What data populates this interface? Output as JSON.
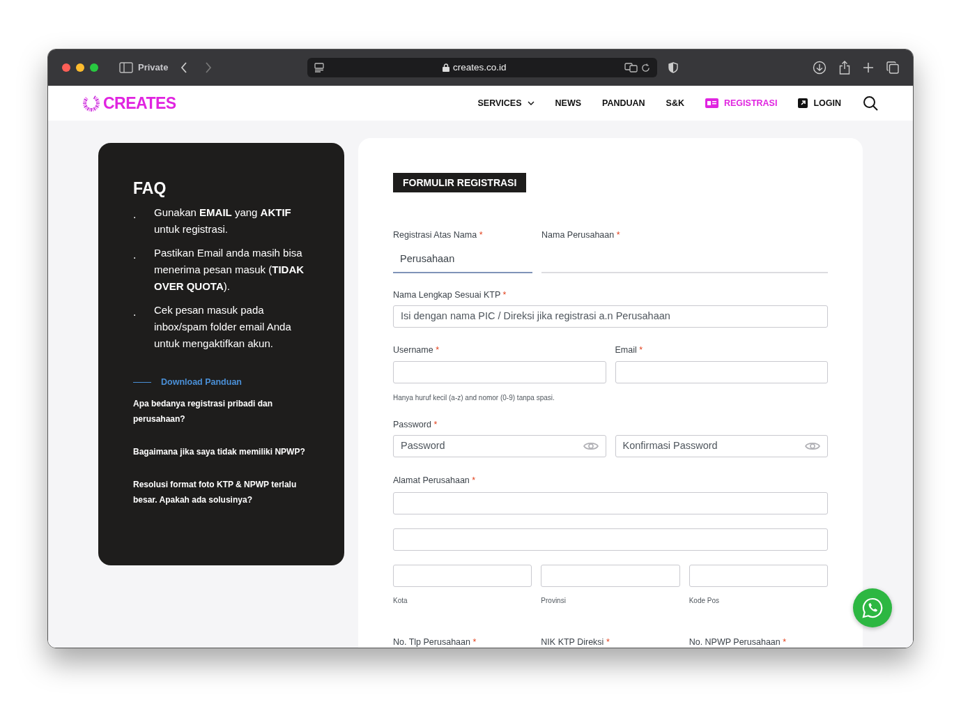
{
  "browser": {
    "mode": "Private",
    "url": "creates.co.id"
  },
  "site": {
    "logo": "CREATES",
    "nav": [
      {
        "label": "SERVICES",
        "kind": "dropdown",
        "selected": false
      },
      {
        "label": "NEWS",
        "kind": "link",
        "selected": false
      },
      {
        "label": "PANDUAN",
        "kind": "link",
        "selected": false
      },
      {
        "label": "S&K",
        "kind": "link",
        "selected": false
      },
      {
        "label": "REGISTRASI",
        "kind": "card",
        "selected": true
      },
      {
        "label": "LOGIN",
        "kind": "login",
        "selected": false
      }
    ]
  },
  "faq": {
    "title": "FAQ",
    "bullet": ".",
    "tips": [
      "Gunakan **EMAIL** yang **AKTIF** untuk registrasi.",
      "Pastikan Email anda masih bisa menerima pesan masuk (**TIDAK OVER QUOTA**).",
      "Cek pesan masuk pada inbox/spam folder email Anda untuk mengaktifkan akun."
    ],
    "download_link": "Download Panduan",
    "questions": [
      "Apa bedanya registrasi pribadi dan perusahaan?",
      "Bagaimana jika saya tidak memiliki NPWP?",
      "Resolusi format foto KTP & NPWP terlalu besar. Apakah ada solusinya?"
    ]
  },
  "form": {
    "title": "FORMULIR REGISTRASI",
    "required_mark": "*",
    "registration_type": {
      "label": "Registrasi Atas Nama",
      "value": "Perusahaan"
    },
    "company_name": {
      "label": "Nama Perusahaan"
    },
    "full_name": {
      "label": "Nama Lengkap Sesuai KTP",
      "placeholder": "Isi dengan nama PIC / Direksi jika registrasi a.n Perusahaan"
    },
    "username": {
      "label": "Username",
      "hint": "Hanya huruf kecil (a-z) and nomor (0-9) tanpa spasi."
    },
    "email": {
      "label": "Email"
    },
    "password": {
      "label": "Password",
      "placeholder": "Password",
      "confirm_placeholder": "Konfirmasi Password"
    },
    "address": {
      "label": "Alamat Perusahaan",
      "parts": [
        "Kota",
        "Provinsi",
        "Kode Pos"
      ]
    },
    "bottom_fields": [
      "No. Tlp Perusahaan",
      "NIK KTP Direksi",
      "No. NPWP Perusahaan"
    ]
  }
}
